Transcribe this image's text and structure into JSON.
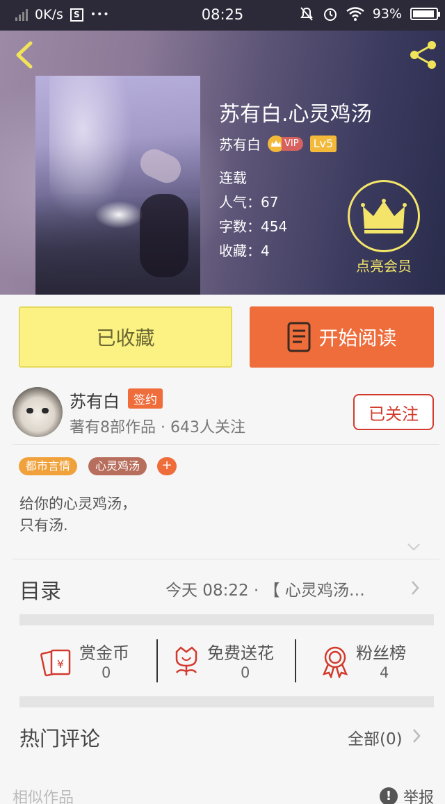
{
  "status_bar": {
    "speed": "0K/s",
    "s_icon": "S",
    "dots": "•••",
    "time": "08:25",
    "battery": "93%",
    "battery_level": 0.93
  },
  "book": {
    "title": "苏有白.心灵鸡汤",
    "author": "苏有白",
    "vip_label": "VIP",
    "level": "Lv5",
    "status": "连载",
    "popularity": "人气：67",
    "word_count": "字数：454",
    "favorites": "收藏：4"
  },
  "vip_badge": {
    "label": "点亮会员"
  },
  "actions": {
    "favorited": "已收藏",
    "start_reading": "开始阅读"
  },
  "author": {
    "name": "苏有白",
    "signed": "签约",
    "stats": "著有8部作品 · 643人关注",
    "follow": "已关注"
  },
  "tags": [
    {
      "label": "都市言情",
      "color": "#f0a13a"
    },
    {
      "label": "心灵鸡汤",
      "color": "#b86e5c"
    }
  ],
  "tag_add": "+",
  "intro": [
    "给你的心灵鸡汤，",
    "只有汤."
  ],
  "catalog": {
    "label": "目录",
    "latest": "今天 08:22 · 【 心灵鸡汤…"
  },
  "stats": [
    {
      "label": "赏金币",
      "value": "0",
      "icon": "red-envelope-icon"
    },
    {
      "label": "免费送花",
      "value": "0",
      "icon": "flower-icon"
    },
    {
      "label": "粉丝榜",
      "value": "4",
      "icon": "medal-icon"
    }
  ],
  "comments": {
    "label": "热门评论",
    "all": "全部(0)"
  },
  "similar": "相似作品",
  "report": "举报",
  "colors": {
    "accent": "#ef6c3b",
    "favorite_bg": "#fbf283",
    "follow": "#d23a2d",
    "vip_gold": "#f4e56a"
  }
}
